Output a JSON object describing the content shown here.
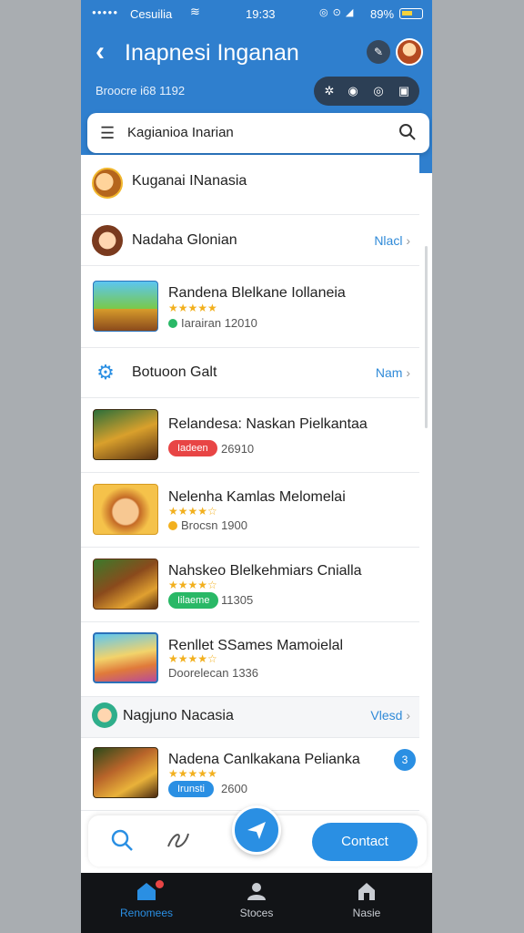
{
  "status": {
    "carrier": "Cesuilia",
    "time": "19:33",
    "battery": "89%",
    "signal_icons": "◎ ⊙ ◢"
  },
  "header": {
    "title": "Inapnesi Inganan",
    "subtitle": "Broocre i68 1192",
    "tool_glyph": "✎"
  },
  "search": {
    "placeholder": "Kagianioa Inarian"
  },
  "list": {
    "top_section": {
      "title": "Kuganai INanasia"
    },
    "sections": [
      {
        "title": "Nadaha Glonian",
        "action": "Nlacl"
      },
      {
        "title": "Botuoon Galt",
        "action": "Nam"
      },
      {
        "title": "Nagjuno Nacasia",
        "action": "Vlesd"
      }
    ],
    "apps": [
      {
        "name": "Randena Blelkane Iollaneia",
        "stars": "★★★★★",
        "meta": "Iarairan 12010",
        "badge": ""
      },
      {
        "name": "Relandesa: Naskan Pielkantaa",
        "stars": "",
        "meta": "26910",
        "badge": "Iadeen"
      },
      {
        "name": "Nelenha Kamlas Melomelai",
        "stars": "★★★★☆",
        "meta": "Brocsn 1900",
        "badge": ""
      },
      {
        "name": "Nahskeo Blelkehmiars Cnialla",
        "stars": "★★★★☆",
        "meta": "11305",
        "badge": "Iilaeme"
      },
      {
        "name": "Renllet SSames Mamoielal",
        "stars": "★★★★☆",
        "meta": "Doorelecan 1336",
        "badge": ""
      },
      {
        "name": "Nadena Canlkakana Pelianka",
        "stars": "★★★★★",
        "meta": "2600",
        "badge": "Irunsti"
      }
    ],
    "corner_badge": "3"
  },
  "actionbar": {
    "contact_label": "Contact"
  },
  "nav": {
    "items": [
      {
        "label": "Renomees"
      },
      {
        "label": "Stoces"
      },
      {
        "label": "Nasie"
      }
    ]
  },
  "colors": {
    "header_blue": "#2f7fce",
    "accent_blue": "#2a8fe3",
    "nav_bg": "#121417",
    "badge_red": "#e84545",
    "badge_green": "#29b866"
  }
}
